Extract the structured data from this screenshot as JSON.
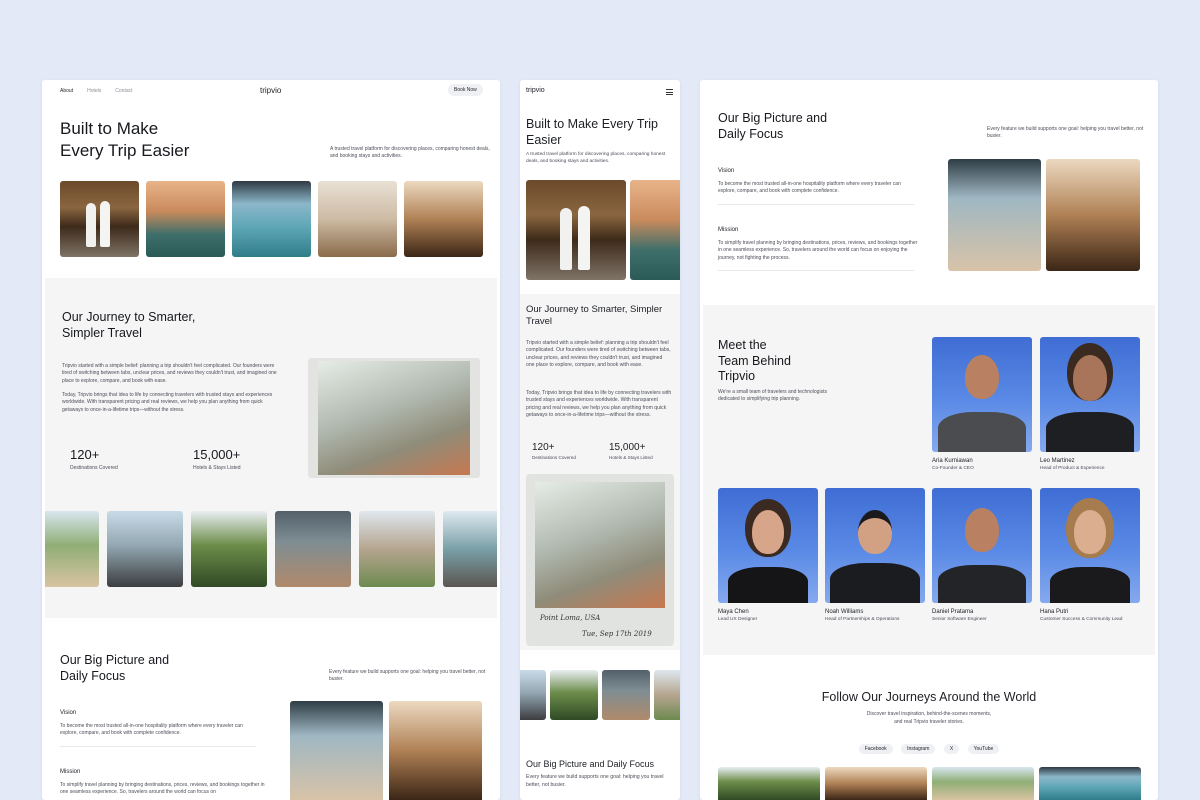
{
  "desktop_home": {
    "nav": {
      "links": [
        "About",
        "Hotels",
        "Contact"
      ],
      "logo": "tripvio",
      "cta": "Book Now"
    },
    "hero": {
      "title_line1": "Built to Make",
      "title_line2": "Every Trip Easier",
      "desc": "A trusted travel platform for discovering places, comparing honest deals, and booking stays and activities."
    },
    "journey": {
      "title_line1": "Our Journey to Smarter,",
      "title_line2": "Simpler Travel",
      "p1": "Tripvio started with a simple belief: planning a trip shouldn't feel complicated. Our founders were tired of switching between tabs, unclear prices, and reviews they couldn't trust, and imagined one place to explore, compare, and book with ease.",
      "p2": "Today, Tripvio brings that idea to life by connecting travelers with trusted stays and experiences worldwide. With transparent pricing and real reviews, we help you plan anything from quick getaways to once-in-a-lifetime trips—without the stress.",
      "stats": [
        {
          "value": "120+",
          "label": "Destinations Covered"
        },
        {
          "value": "15,000+",
          "label": "Hotels & Stays Listed"
        }
      ]
    },
    "bigpicture": {
      "title_line1": "Our Big Picture and",
      "title_line2": "Daily Focus",
      "desc": "Every feature we build supports one goal: helping you travel better, not busier.",
      "vision_title": "Vision",
      "vision_text": "To become the most trusted all-in-one hospitality platform where every traveler can explore, compare, and book with complete confidence.",
      "mission_title": "Mission",
      "mission_text": "To simplify travel planning by bringing destinations, prices, reviews, and bookings together in one seamless experience. So, travelers around the world can focus on"
    }
  },
  "mobile": {
    "logo": "tripvio",
    "menu_icon": "hamburger-icon",
    "hero_title": "Built to Make Every Trip Easier",
    "hero_desc": "A trusted travel platform for discovering places, comparing honest deals, and booking stays and activities.",
    "journey_title": "Our Journey to Smarter, Simpler Travel",
    "p1": "Tripvio started with a simple belief: planning a trip shouldn't feel complicated. Our founders were tired of switching between tabs, unclear prices, and reviews they couldn't trust, and imagined one place to explore, compare, and book with ease.",
    "p2": "Today, Tripvio brings that idea to life by connecting travelers with trusted stays and experiences worldwide. With transparent pricing and real reviews, we help you plan anything from quick getaways to once-in-a-lifetime trips—without the stress.",
    "stats": [
      {
        "value": "120+",
        "label": "Destinations Covered"
      },
      {
        "value": "15,000+",
        "label": "Hotels & Stays Listed"
      }
    ],
    "polaroid_caption1": "Point Loma, USA",
    "polaroid_caption2": "Tue, Sep 17th 2019",
    "bigpicture_title": "Our Big Picture and Daily Focus",
    "bigpicture_desc": "Every feature we build supports one goal: helping you travel better, not busier."
  },
  "desktop_about": {
    "bigpicture": {
      "title_line1": "Our Big Picture and",
      "title_line2": "Daily Focus",
      "desc": "Every feature we build supports one goal: helping you travel better, not busier.",
      "vision_title": "Vision",
      "vision_text": "To become the most trusted all-in-one hospitality platform where every traveler can explore, compare, and book with complete confidence.",
      "mission_title": "Mission",
      "mission_text": "To simplify travel planning by bringing destinations, prices, reviews, and bookings together in one seamless experience. So, travelers around the world can focus on enjoying the journey, not fighting the process."
    },
    "team": {
      "title_line1": "Meet the",
      "title_line2": "Team Behind",
      "title_line3": "Tripvio",
      "desc": "We're a small team of travelers and technologists dedicated to simplifying trip planning.",
      "members": [
        {
          "name": "Aria Kurniawan",
          "role": "Co-Founder & CEO"
        },
        {
          "name": "Leo Martinez",
          "role": "Head of Product & Experience"
        },
        {
          "name": "Maya Chen",
          "role": "Lead UX Designer"
        },
        {
          "name": "Noah Williams",
          "role": "Head of Partnerships & Operations"
        },
        {
          "name": "Daniel Pratama",
          "role": "Senior Software Engineer"
        },
        {
          "name": "Hana Putri",
          "role": "Customer Success & Community Lead"
        }
      ]
    },
    "follow": {
      "title": "Follow Our Journeys Around the World",
      "desc_line1": "Discover travel inspiration, behind-the-scenes moments,",
      "desc_line2": "and real Tripvio traveler stories.",
      "socials": [
        "Facebook",
        "Instagram",
        "X",
        "YouTube"
      ]
    }
  },
  "colors": {
    "background": "#e3e9f7",
    "section_gray": "#f5f5f6",
    "team_blue": "#4a78dc",
    "text": "#16181d"
  }
}
